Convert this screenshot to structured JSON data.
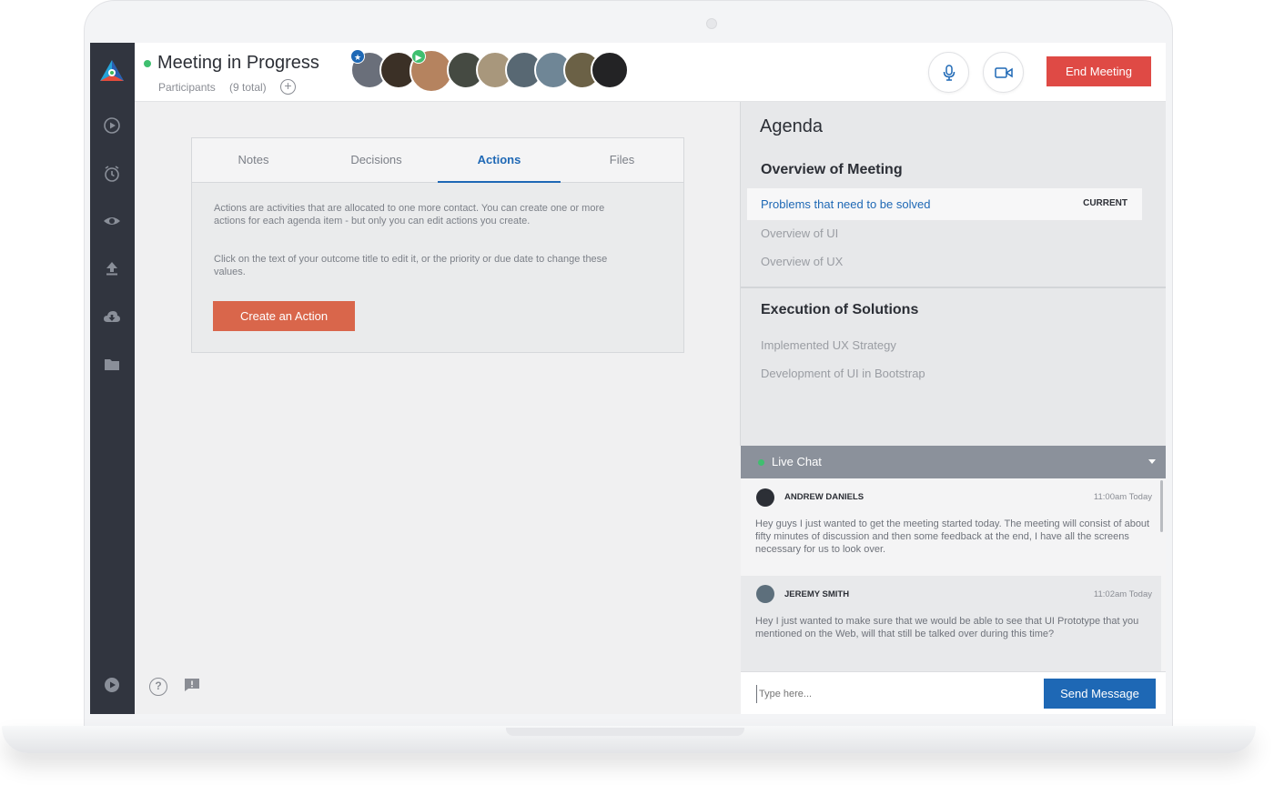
{
  "header": {
    "title": "Meeting in Progress",
    "participants_label": "Participants",
    "participants_count": "(9 total)",
    "add_participant_symbol": "+",
    "end_meeting_label": "End Meeting"
  },
  "avatars": [
    {
      "color": "#6a6f7a",
      "badge": "star"
    },
    {
      "color": "#3b3026"
    },
    {
      "color": "#b5835f",
      "badge": "play"
    },
    {
      "color": "#454a42"
    },
    {
      "color": "#a8977c"
    },
    {
      "color": "#586873"
    },
    {
      "color": "#6f8696"
    },
    {
      "color": "#6b6146"
    },
    {
      "color": "#232325"
    }
  ],
  "tabs": [
    "Notes",
    "Decisions",
    "Actions",
    "Files"
  ],
  "active_tab": "Actions",
  "actions": {
    "description_1": "Actions are activities that are allocated to one more contact. You can create one or more actions for each agenda item - but only you can edit actions you create.",
    "description_2": "Click on the text of your outcome title to edit it, or the priority or due date to change these values.",
    "create_label": "Create an Action"
  },
  "agenda": {
    "title": "Agenda",
    "sections": [
      {
        "title": "Overview of Meeting",
        "current_item": "Problems that need to be solved",
        "current_badge": "CURRENT",
        "items": [
          "Overview of UI",
          "Overview of UX"
        ]
      },
      {
        "title": "Execution of Solutions",
        "items": [
          "Implemented UX Strategy",
          "Development of UI in Bootstrap"
        ]
      }
    ]
  },
  "chat": {
    "title": "Live Chat",
    "messages": [
      {
        "name": "ANDREW DANIELS",
        "time": "11:00am Today",
        "text": "Hey guys I just wanted to get the meeting started today. The meeting will consist of about fifty minutes of discussion and then some feedback at the end, I have all the screens necessary for us to look over."
      },
      {
        "name": "JEREMY SMITH",
        "time": "11:02am Today",
        "text": "Hey I just wanted to make sure that we would be able to see that UI Prototype that you mentioned on the Web, will that still be talked over during this time?"
      }
    ],
    "input_placeholder": "Type here...",
    "send_label": "Send Message"
  },
  "colors": {
    "sidebar": "#31353f",
    "accent_blue": "#1e68b5",
    "end_meeting_red": "#df4a45",
    "create_action_orange": "#d9664b",
    "online_green": "#3fbf6f"
  },
  "icons": {
    "sidebar": [
      "play-circle-icon",
      "alarm-clock-icon",
      "eye-icon",
      "upload-icon",
      "cloud-download-icon",
      "folder-icon",
      "play-circle-filled-icon"
    ],
    "header": [
      "microphone-icon",
      "video-camera-icon"
    ],
    "footer": [
      "help-icon",
      "feedback-icon"
    ]
  }
}
